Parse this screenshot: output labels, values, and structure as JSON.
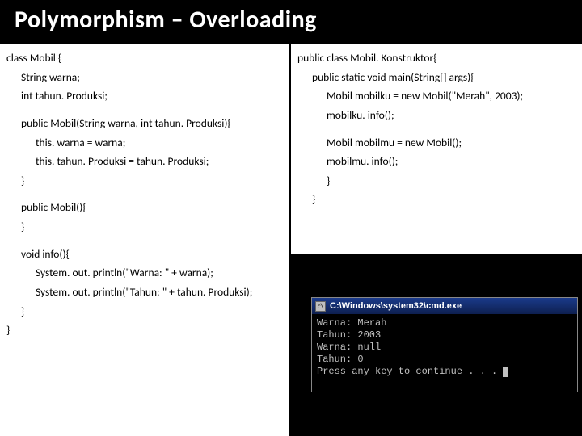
{
  "title": "Polymorphism – Overloading",
  "left": {
    "l1": "class Mobil {",
    "l2": "String warna;",
    "l3": "int tahun. Produksi;",
    "l4": "public Mobil(String warna, int tahun. Produksi){",
    "l5": "this. warna = warna;",
    "l6": "this. tahun. Produksi = tahun. Produksi;",
    "l7": "}",
    "l8": "public Mobil(){",
    "l9": "}",
    "l10": "void info(){",
    "l11": "System. out. println(\"Warna: \" + warna);",
    "l12": "System. out. println(\"Tahun: \" + tahun. Produksi);",
    "l13": "}",
    "l14": "}"
  },
  "right": {
    "r1": "public class Mobil. Konstruktor{",
    "r2": "public static void main(String[] args){",
    "r3": "Mobil mobilku = new Mobil(\"Merah\", 2003);",
    "r4": "mobilku. info();",
    "r5": "Mobil mobilmu = new Mobil();",
    "r6": "mobilmu. info();",
    "r7": "}",
    "r8": "}"
  },
  "console": {
    "title": "C:\\Windows\\system32\\cmd.exe",
    "out1": "Warna: Merah",
    "out2": "Tahun: 2003",
    "out3": "Warna: null",
    "out4": "Tahun: 0",
    "out5": "Press any key to continue . . . "
  }
}
